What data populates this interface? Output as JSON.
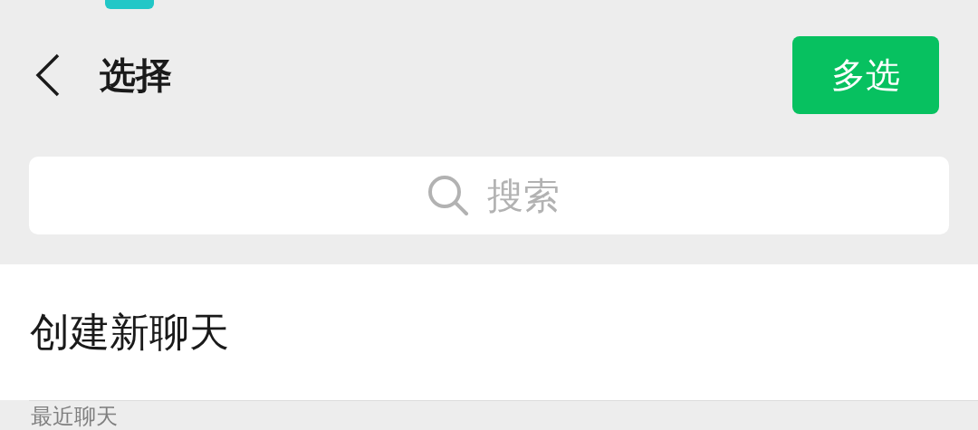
{
  "header": {
    "title": "选择",
    "action_button": "多选"
  },
  "search": {
    "placeholder": "搜索"
  },
  "list": {
    "items": [
      "创建新聊天"
    ]
  },
  "section_header": "最近聊天"
}
